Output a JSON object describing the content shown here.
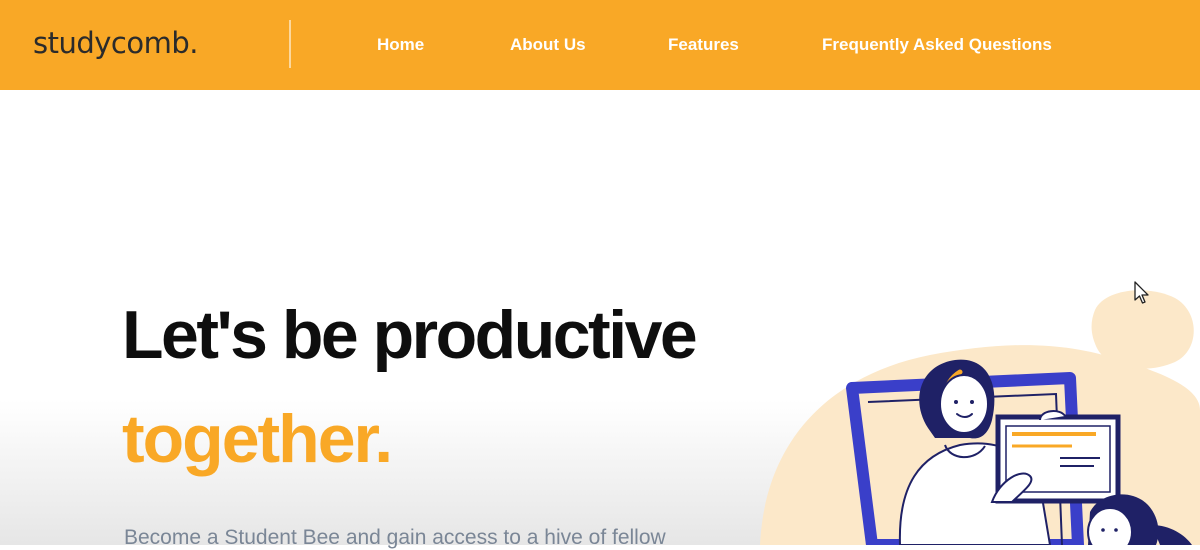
{
  "header": {
    "brand": "studycomb.",
    "nav": [
      {
        "label": "Home"
      },
      {
        "label": "About Us"
      },
      {
        "label": "Features"
      },
      {
        "label": "Frequently Asked Questions"
      }
    ]
  },
  "hero": {
    "headline": "Let's be productive",
    "headline_accent": "together.",
    "subtext": "Become a Student Bee and gain access to a hive of fellow"
  },
  "colors": {
    "accent": "#f9a826",
    "heading": "#0e0e0e",
    "nav_text": "#ffffff",
    "illustration_blue": "#3a3fc9",
    "illustration_bg": "#fbe5c4"
  },
  "icons": {
    "cursor": "mouse-pointer-icon",
    "illustration": "students-video-call-illustration"
  }
}
